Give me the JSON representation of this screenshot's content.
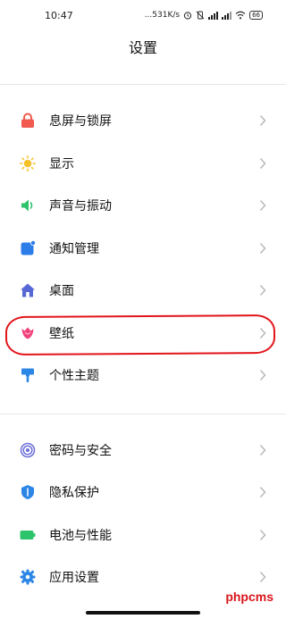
{
  "status_bar": {
    "time": "10:47",
    "net_speed": "...531K/s",
    "battery_level": "66"
  },
  "page": {
    "title": "设置"
  },
  "groups": [
    {
      "items": [
        {
          "label": "息屏与锁屏",
          "icon": "lock-icon",
          "color": "#f05a4f"
        },
        {
          "label": "显示",
          "icon": "sun-icon",
          "color": "#f6c22b"
        },
        {
          "label": "声音与振动",
          "icon": "speaker-icon",
          "color": "#2cc36b"
        },
        {
          "label": "通知管理",
          "icon": "notification-icon",
          "color": "#2c7de8"
        },
        {
          "label": "桌面",
          "icon": "home-icon",
          "color": "#5667d6"
        },
        {
          "label": "壁纸",
          "icon": "tulip-icon",
          "color": "#f0417a"
        },
        {
          "label": "个性主题",
          "icon": "brush-icon",
          "color": "#2c86e6"
        }
      ]
    },
    {
      "items": [
        {
          "label": "密码与安全",
          "icon": "fingerprint-icon",
          "color": "#6a6fd8"
        },
        {
          "label": "隐私保护",
          "icon": "shield-icon",
          "color": "#2c86e6"
        },
        {
          "label": "电池与性能",
          "icon": "battery-icon",
          "color": "#2cc36b"
        },
        {
          "label": "应用设置",
          "icon": "gear-icon",
          "color": "#2c86e6"
        }
      ]
    }
  ],
  "watermark": "phpcms"
}
